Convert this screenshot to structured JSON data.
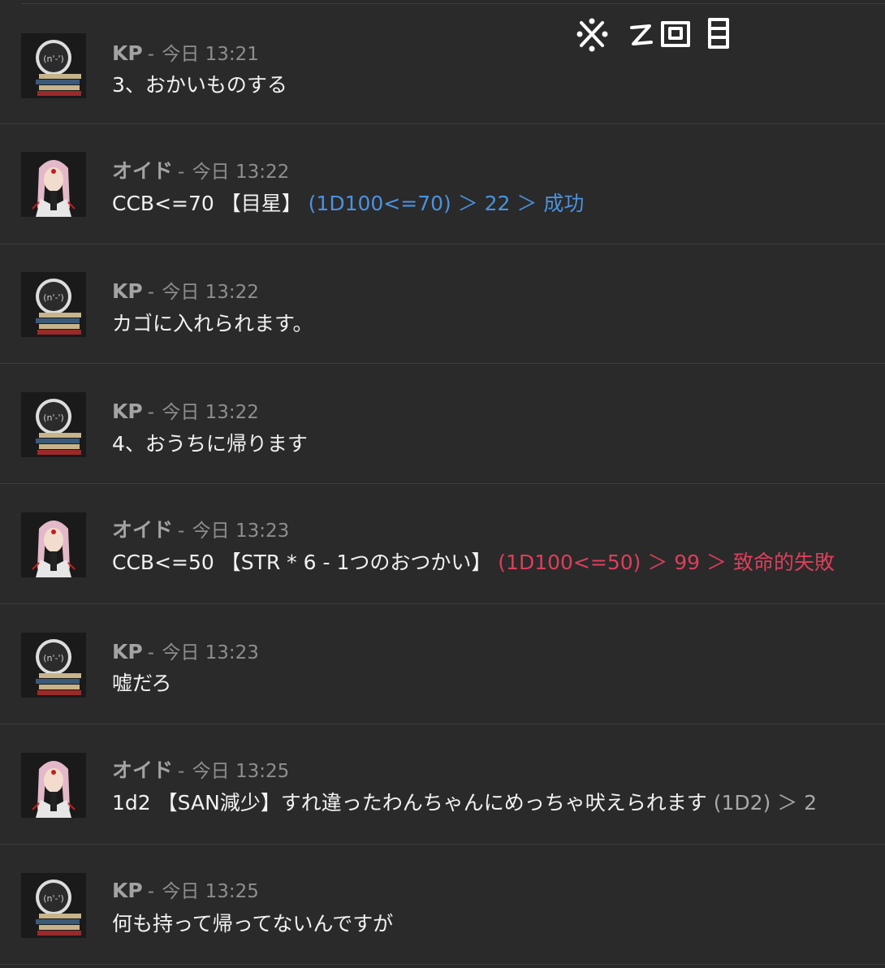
{
  "annotation": "※2回目",
  "messages": [
    {
      "author": "KP",
      "sep": "-",
      "time": "今日 13:21",
      "text": "3、おかいものする",
      "roll": "",
      "avatar": "kp-avatar-icon"
    },
    {
      "author": "オイド",
      "sep": "-",
      "time": "今日 13:22",
      "text": "CCB<=70 【目星】 ",
      "roll": "(1D100<=70) ＞ 22 ＞ 成功",
      "roll_color": "#4a92e0",
      "avatar": "oido-avatar-icon"
    },
    {
      "author": "KP",
      "sep": "-",
      "time": "今日 13:22",
      "text": "カゴに入れられます。",
      "roll": "",
      "avatar": "kp-avatar-icon"
    },
    {
      "author": "KP",
      "sep": "-",
      "time": "今日 13:22",
      "text": "4、おうちに帰ります",
      "roll": "",
      "avatar": "kp-avatar-icon"
    },
    {
      "author": "オイド",
      "sep": "-",
      "time": "今日 13:23",
      "text": "CCB<=50 【STR * 6  - 1つのおつかい】 ",
      "roll": "(1D100<=50) ＞ 99 ＞ 致命的失敗",
      "roll_color": "#dc3f5c",
      "avatar": "oido-avatar-icon"
    },
    {
      "author": "KP",
      "sep": "-",
      "time": "今日 13:23",
      "text": "嘘だろ",
      "roll": "",
      "avatar": "kp-avatar-icon"
    },
    {
      "author": "オイド",
      "sep": "-",
      "time": "今日 13:25",
      "text": "1d2 【SAN減少】すれ違ったわんちゃんにめっちゃ吠えられます ",
      "roll": "(1D2) ＞ 2",
      "roll_color": "#a8a8a8",
      "avatar": "oido-avatar-icon"
    },
    {
      "author": "KP",
      "sep": "-",
      "time": "今日 13:25",
      "text": "何も持って帰ってないんですが",
      "roll": "",
      "avatar": "kp-avatar-icon"
    }
  ]
}
